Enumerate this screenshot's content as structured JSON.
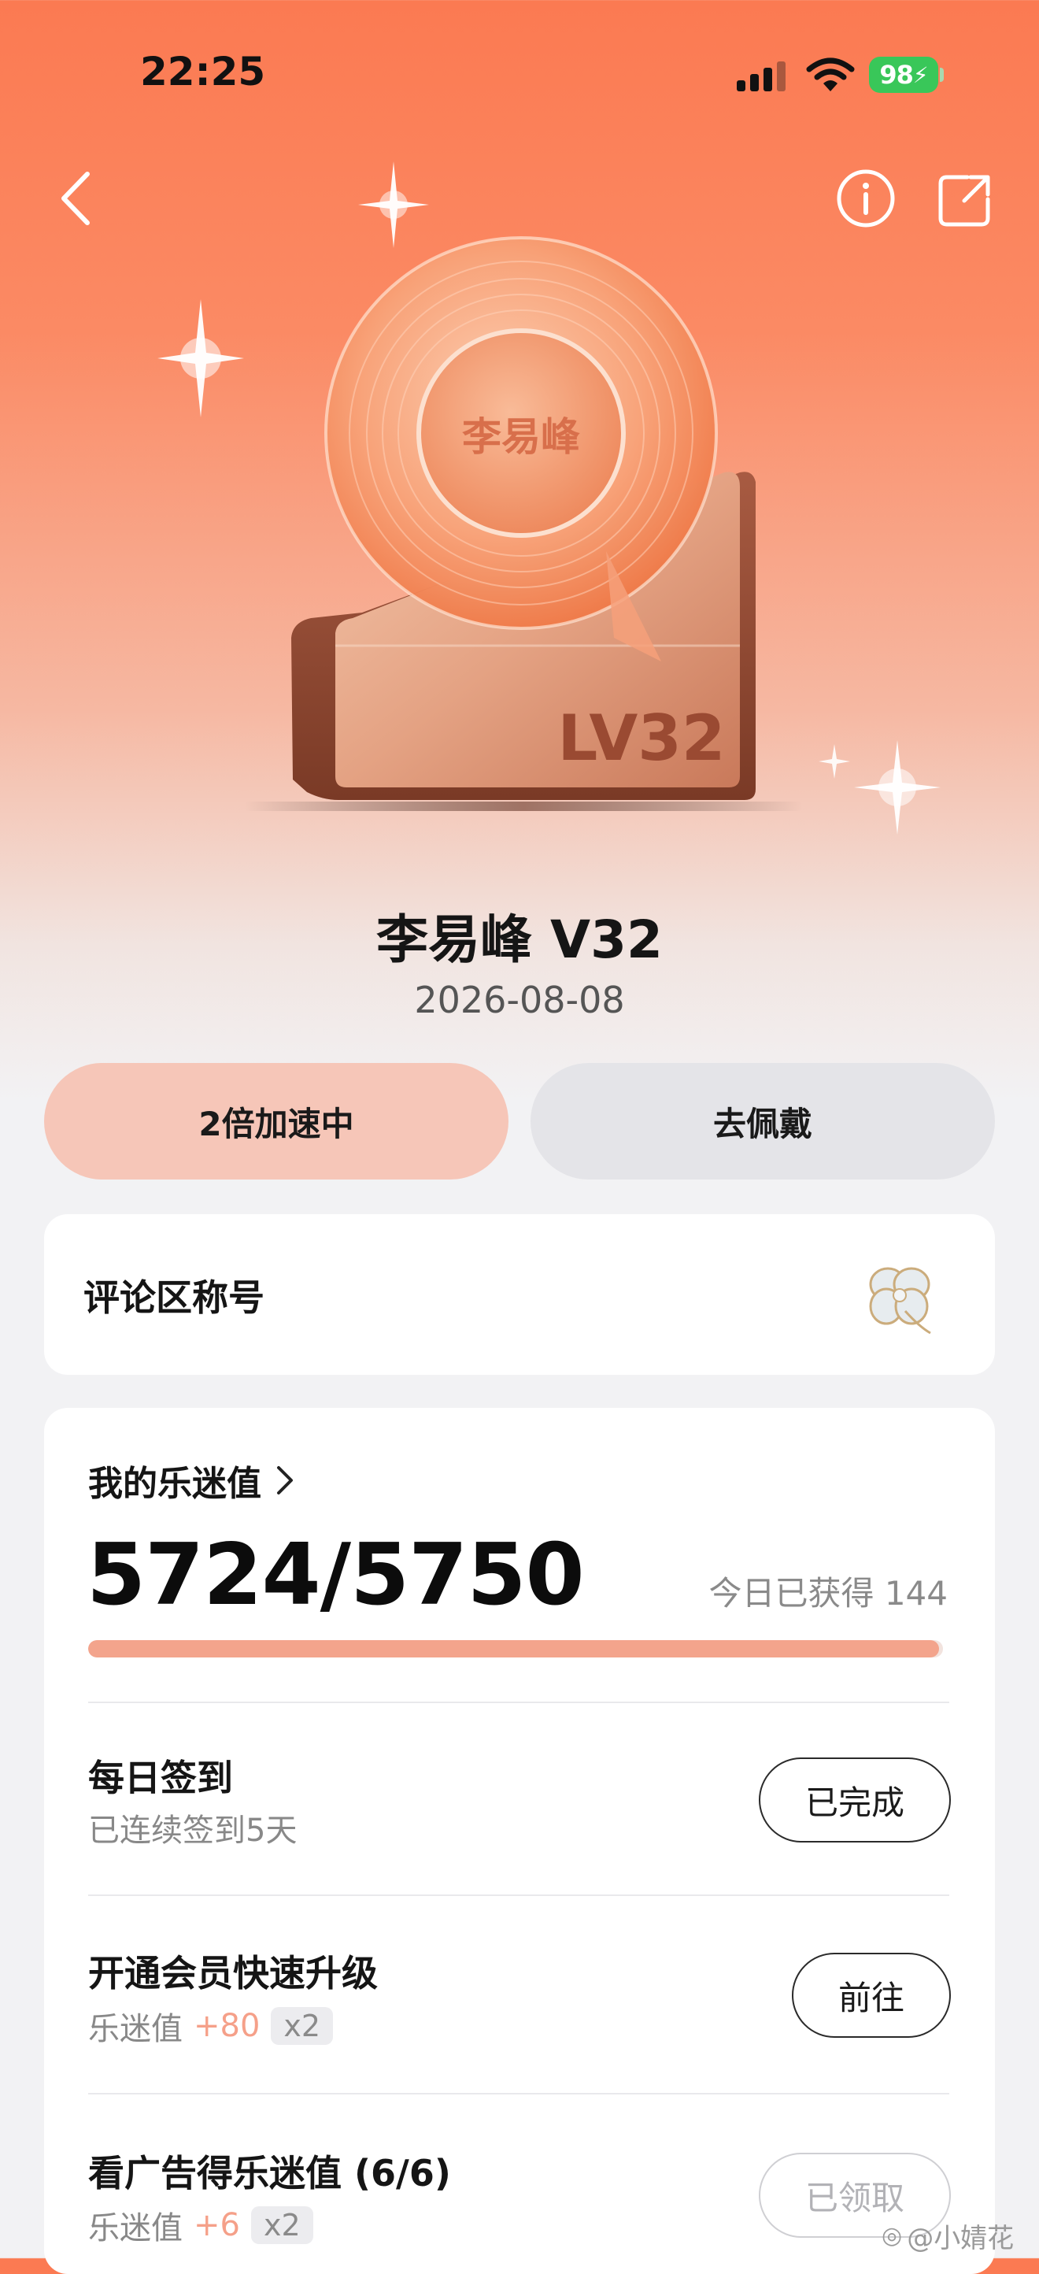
{
  "status_bar": {
    "time": "22:25",
    "battery": "98"
  },
  "badge": {
    "singer_name": "李易峰",
    "level_text": "LV32"
  },
  "header": {
    "title": "李易峰 V32",
    "date": "2026-08-08"
  },
  "actions": {
    "speed_label": "2倍加速中",
    "wear_label": "去佩戴"
  },
  "comment_title": {
    "label": "评论区称号"
  },
  "fan_value": {
    "label": "我的乐迷值",
    "current": "5724/5750",
    "today_label": "今日已获得 144",
    "progress": 0.995
  },
  "tasks": [
    {
      "title": "每日签到",
      "subtitle": "已连续签到5天",
      "button": "已完成"
    },
    {
      "title": "开通会员快速升级",
      "sub_prefix": "乐迷值",
      "plus": "+80",
      "multiplier": "x2",
      "button": "前往"
    },
    {
      "title": "看广告得乐迷值 (6/6)",
      "sub_prefix": "乐迷值",
      "plus": "+6",
      "multiplier": "x2",
      "button": "已领取"
    }
  ],
  "watermark": "@小婧花",
  "colors": {
    "accent": "#fb7a52",
    "progress": "#f3a48c",
    "pill_active": "#f6c6b8"
  }
}
